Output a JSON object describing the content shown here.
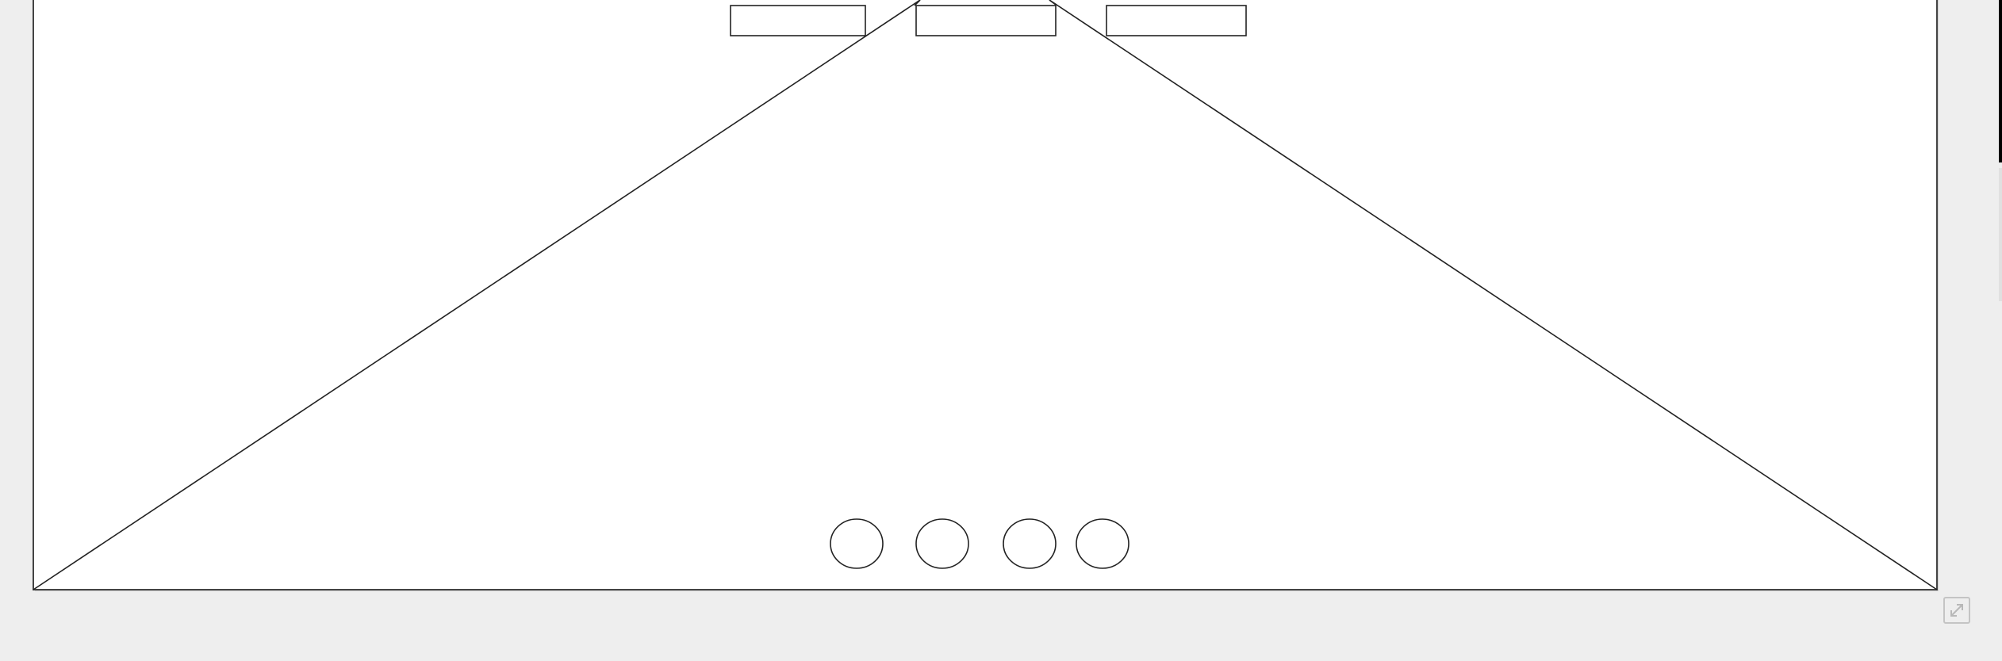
{
  "diagram": {
    "page_color": "#ffffff",
    "background_color": "#eeeeee",
    "stroke_color": "#222222",
    "boxes": [
      {
        "label": ""
      },
      {
        "label": ""
      },
      {
        "label": ""
      }
    ],
    "circles": [
      {
        "label": ""
      },
      {
        "label": ""
      },
      {
        "label": ""
      },
      {
        "label": ""
      }
    ]
  },
  "controls": {
    "expand_icon": "expand-arrows-icon"
  }
}
